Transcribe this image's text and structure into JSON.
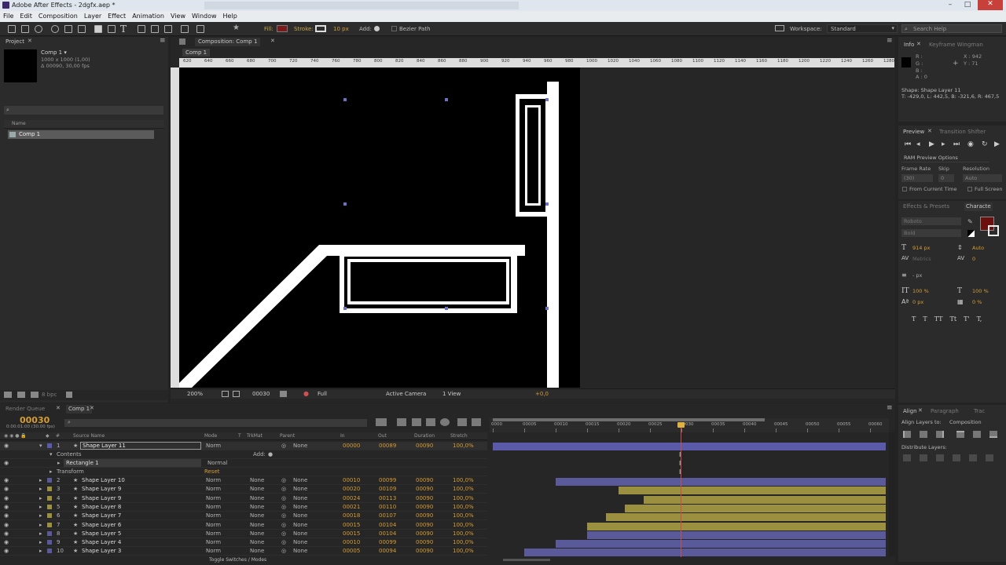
{
  "title_bar": {
    "title": "Adobe After Effects - 2dgfx.aep *"
  },
  "menu": [
    "File",
    "Edit",
    "Composition",
    "Layer",
    "Effect",
    "Animation",
    "View",
    "Window",
    "Help"
  ],
  "toolbar": {
    "fill_label": "Fill:",
    "stroke_label": "Stroke:",
    "stroke_width": "10 px",
    "add_label": "Add:",
    "bezier_label": "Bezier Path",
    "workspace_label": "Workspace:",
    "workspace_value": "Standard",
    "search_placeholder": "Search Help"
  },
  "project": {
    "tab": "Project",
    "comp_name": "Comp 1 ▾",
    "comp_size": "1000 x 1000 (1,00)",
    "comp_duration": "Δ 00090, 30,00 fps",
    "col_name": "Name",
    "item": "Comp 1",
    "bpc": "8 bpc"
  },
  "composition": {
    "tab": "Composition: Comp 1",
    "comp_tab": "Comp 1",
    "ruler": [
      "620",
      "640",
      "660",
      "680",
      "700",
      "720",
      "740",
      "760",
      "780",
      "800",
      "820",
      "840",
      "860",
      "880",
      "900",
      "920",
      "940",
      "960",
      "980",
      "1000",
      "1020",
      "1040",
      "1060",
      "1080",
      "1100",
      "1120",
      "1140",
      "1160",
      "1180",
      "1200",
      "1220",
      "1240",
      "1260",
      "1280"
    ],
    "footer": {
      "zoom": "200%",
      "timecode": "00030",
      "quality": "Full",
      "camera": "Active Camera",
      "view": "1 View",
      "offset": "+0,0"
    }
  },
  "info": {
    "tab": "Info",
    "tab2": "Keyframe Wingman",
    "r": "R :",
    "g": "G :",
    "b": "B :",
    "a": "A : 0",
    "x": "X : 942",
    "y": "Y : 71",
    "shape_line1": "Shape: Shape Layer 11",
    "shape_line2": "T: -429,0, L: 442,5, B: -321,6, R: 467,5"
  },
  "preview": {
    "tab": "Preview",
    "tab2": "Transition Shifter",
    "ram": "RAM Preview Options",
    "frame_rate": "Frame Rate",
    "skip": "Skip",
    "resolution": "Resolution",
    "fr_val": "(30)",
    "skip_val": "0",
    "res_val": "Auto",
    "from_current": "From Current Time",
    "full_screen": "Full Screen"
  },
  "character": {
    "tab1": "Effects & Presets",
    "tab2": "Characte",
    "font": "Roboto",
    "style": "Bold",
    "size": "914 px",
    "leading": "Auto",
    "kerning": "Metrics",
    "tracking": "0",
    "indent": "- px",
    "vscale": "100 %",
    "hscale": "100 %",
    "baseline": "0 px",
    "tsume": "0 %",
    "styles": [
      "T",
      "T",
      "TT",
      "Tt",
      "T'",
      "T,"
    ]
  },
  "align": {
    "tab1": "Align",
    "tab2": "Paragraph",
    "tab3": "Trac",
    "align_to_label": "Align Layers to:",
    "align_to_value": "Composition",
    "distribute": "Distribute Layers:"
  },
  "timeline": {
    "tab1": "Render Queue",
    "tab2": "Comp 1",
    "timecode": "00030",
    "timecode_sub": "0:00:01:00 (30.00 fps)",
    "columns": {
      "source": "Source Name",
      "mode": "Mode",
      "trkmat": "TrkMat",
      "parent": "Parent",
      "in": "In",
      "out": "Out",
      "duration": "Duration",
      "stretch": "Stretch"
    },
    "ruler": [
      "0000",
      "00005",
      "00010",
      "00015",
      "00020",
      "00025",
      "00030",
      "00035",
      "00040",
      "00045",
      "00050",
      "00055",
      "00060"
    ],
    "toggle": "Toggle Switches / Modes",
    "layer1": {
      "num": "1",
      "name": "Shape Layer 11",
      "mode": "Norm",
      "parent": "None",
      "in": "00000",
      "out": "00089",
      "dur": "00090",
      "stretch": "100,0%"
    },
    "contents": "Contents",
    "add": "Add:",
    "rect": "Rectangle 1",
    "rect_mode": "Normal",
    "transform": "Transform",
    "reset": "Reset",
    "layers": [
      {
        "num": "2",
        "name": "Shape Layer 10",
        "mode": "Norm",
        "trk": "None",
        "parent": "None",
        "in": "00010",
        "out": "00099",
        "dur": "00090",
        "stretch": "100,0%",
        "start": 10,
        "color": "#5a5a9a"
      },
      {
        "num": "3",
        "name": "Shape Layer 9",
        "mode": "Norm",
        "trk": "None",
        "parent": "None",
        "in": "00020",
        "out": "00109",
        "dur": "00090",
        "stretch": "100,0%",
        "start": 20,
        "color": "#9a9040"
      },
      {
        "num": "4",
        "name": "Shape Layer 9",
        "mode": "Norm",
        "trk": "None",
        "parent": "None",
        "in": "00024",
        "out": "00113",
        "dur": "00090",
        "stretch": "100,0%",
        "start": 24,
        "color": "#9a9040"
      },
      {
        "num": "5",
        "name": "Shape Layer 8",
        "mode": "Norm",
        "trk": "None",
        "parent": "None",
        "in": "00021",
        "out": "00110",
        "dur": "00090",
        "stretch": "100,0%",
        "start": 21,
        "color": "#9a9040"
      },
      {
        "num": "6",
        "name": "Shape Layer 7",
        "mode": "Norm",
        "trk": "None",
        "parent": "None",
        "in": "00018",
        "out": "00107",
        "dur": "00090",
        "stretch": "100,0%",
        "start": 18,
        "color": "#9a9040"
      },
      {
        "num": "7",
        "name": "Shape Layer 6",
        "mode": "Norm",
        "trk": "None",
        "parent": "None",
        "in": "00015",
        "out": "00104",
        "dur": "00090",
        "stretch": "100,0%",
        "start": 15,
        "color": "#9a9040"
      },
      {
        "num": "8",
        "name": "Shape Layer 5",
        "mode": "Norm",
        "trk": "None",
        "parent": "None",
        "in": "00015",
        "out": "00104",
        "dur": "00090",
        "stretch": "100,0%",
        "start": 15,
        "color": "#5a5a9a"
      },
      {
        "num": "9",
        "name": "Shape Layer 4",
        "mode": "Norm",
        "trk": "None",
        "parent": "None",
        "in": "00010",
        "out": "00099",
        "dur": "00090",
        "stretch": "100,0%",
        "start": 10,
        "color": "#5a5a9a"
      },
      {
        "num": "10",
        "name": "Shape Layer 3",
        "mode": "Norm",
        "trk": "None",
        "parent": "None",
        "in": "00005",
        "out": "00094",
        "dur": "00090",
        "stretch": "100,0%",
        "start": 5,
        "color": "#5a5a9a"
      }
    ]
  }
}
